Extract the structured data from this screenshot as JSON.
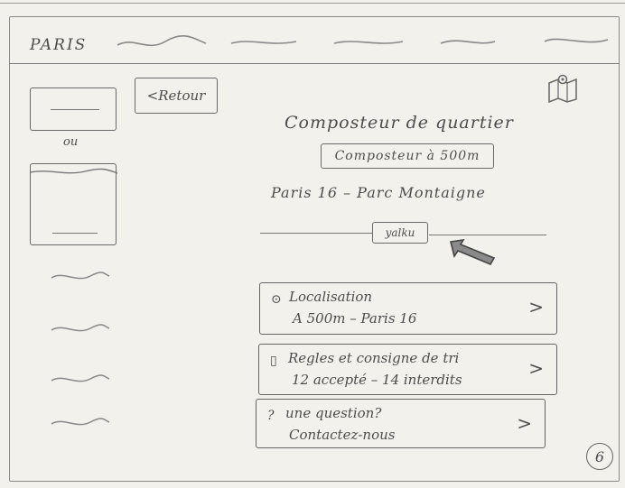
{
  "header": {
    "title": "PARIS"
  },
  "sidebar": {
    "separator_text": "ou"
  },
  "toolbar": {
    "back_label": "<Retour"
  },
  "main": {
    "section_title": "Composteur de quartier",
    "distance_button_label": "Composteur à 500m",
    "address": "Paris 16 – Parc Montaigne",
    "logo_label": "yalku"
  },
  "rows": [
    {
      "icon": "location-icon",
      "icon_glyph": "⊙",
      "title": "Localisation",
      "subtitle": "A 500m – Paris 16"
    },
    {
      "icon": "document-icon",
      "icon_glyph": "▯",
      "title": "Regles et consigne de tri",
      "subtitle": "12 accepté – 14 interdits"
    },
    {
      "icon": "question-icon",
      "icon_glyph": "?",
      "title": "une question?",
      "subtitle": "Contactez-nous"
    }
  ],
  "chevron_glyph": ">",
  "corner_badge": "6",
  "icons": {
    "map": "map-pin-icon",
    "cursor": "arrow-pointer-icon"
  }
}
